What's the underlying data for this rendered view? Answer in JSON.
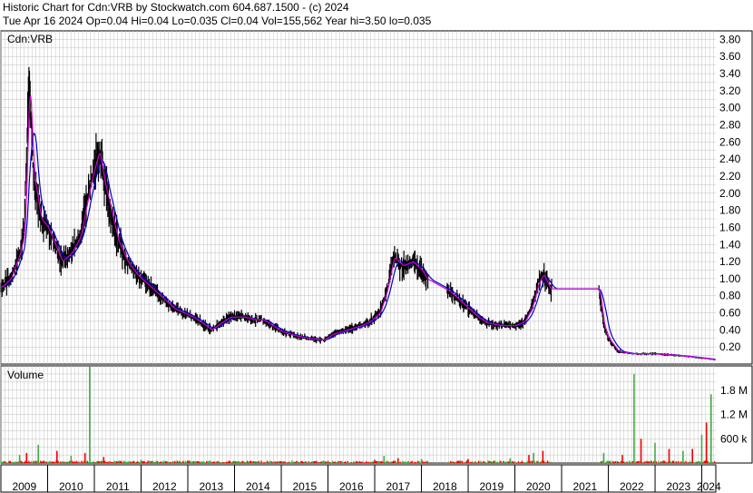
{
  "header": {
    "line1": "Historic Chart for Cdn:VRB by Stockwatch.com 604.687.1500 - (c) 2024",
    "line2": "Tue Apr 16 2024   Op=0.04   Hi=0.04   Lo=0.035   Cl=0.04   Vol=155,562   Year hi=3.50   lo=0.035"
  },
  "colors": {
    "price_bars": "#000000",
    "ma_short": "#cc00cc",
    "ma_long": "#0000cc",
    "vol_up": "#44aa44",
    "vol_down": "#ee0000",
    "grid": "#c0c0c0"
  },
  "chart_data": [
    {
      "type": "line",
      "title": "Cdn:VRB",
      "xlabel": "",
      "ylabel": "",
      "ylim": [
        0,
        3.9
      ],
      "yticks": [
        "3.80",
        "3.60",
        "3.40",
        "3.20",
        "3.00",
        "2.80",
        "2.60",
        "2.40",
        "2.20",
        "2.00",
        "1.80",
        "1.60",
        "1.40",
        "1.20",
        "1.00",
        "0.80",
        "0.60",
        "0.40",
        "0.20"
      ],
      "x_range": [
        2009.0,
        2024.3
      ],
      "x_ticks": [
        "2009",
        "2010",
        "2011",
        "2012",
        "2013",
        "2014",
        "2015",
        "2016",
        "2017",
        "2018",
        "2019",
        "2020",
        "2021",
        "2022",
        "2023",
        "2024"
      ],
      "grid": true,
      "series": [
        {
          "values": [
            [
              2009.0,
              0.9
            ],
            [
              2009.2,
              1.0
            ],
            [
              2009.4,
              1.3
            ],
            [
              2009.5,
              1.55
            ],
            [
              2009.6,
              3.35
            ],
            [
              2009.7,
              2.2
            ],
            [
              2009.85,
              1.7
            ],
            [
              2010.0,
              1.6
            ],
            [
              2010.15,
              1.4
            ],
            [
              2010.3,
              1.2
            ],
            [
              2010.5,
              1.3
            ],
            [
              2010.7,
              1.5
            ],
            [
              2010.8,
              1.8
            ],
            [
              2010.95,
              2.2
            ],
            [
              2011.1,
              2.5
            ],
            [
              2011.2,
              2.15
            ],
            [
              2011.35,
              1.8
            ],
            [
              2011.5,
              1.45
            ],
            [
              2011.7,
              1.2
            ],
            [
              2011.9,
              1.05
            ],
            [
              2012.1,
              0.95
            ],
            [
              2012.3,
              0.85
            ],
            [
              2012.5,
              0.75
            ],
            [
              2012.7,
              0.65
            ],
            [
              2012.9,
              0.6
            ],
            [
              2013.1,
              0.55
            ],
            [
              2013.3,
              0.48
            ],
            [
              2013.5,
              0.4
            ],
            [
              2013.7,
              0.48
            ],
            [
              2013.9,
              0.55
            ],
            [
              2014.2,
              0.55
            ],
            [
              2014.4,
              0.52
            ],
            [
              2014.6,
              0.52
            ],
            [
              2014.8,
              0.45
            ],
            [
              2015.0,
              0.38
            ],
            [
              2015.3,
              0.33
            ],
            [
              2015.6,
              0.3
            ],
            [
              2015.9,
              0.28
            ],
            [
              2016.1,
              0.35
            ],
            [
              2016.4,
              0.4
            ],
            [
              2016.7,
              0.45
            ],
            [
              2016.9,
              0.5
            ],
            [
              2017.1,
              0.6
            ],
            [
              2017.25,
              0.85
            ],
            [
              2017.4,
              1.25
            ],
            [
              2017.6,
              1.15
            ],
            [
              2017.8,
              1.2
            ],
            [
              2018.0,
              1.1
            ],
            [
              2018.1,
              1.0
            ],
            [
              2018.6,
              0.85
            ],
            [
              2018.8,
              0.75
            ],
            [
              2019.0,
              0.65
            ],
            [
              2019.2,
              0.55
            ],
            [
              2019.4,
              0.48
            ],
            [
              2019.7,
              0.45
            ],
            [
              2020.0,
              0.45
            ],
            [
              2020.2,
              0.5
            ],
            [
              2020.35,
              0.65
            ],
            [
              2020.5,
              0.95
            ],
            [
              2020.6,
              1.05
            ],
            [
              2020.75,
              0.88
            ],
            [
              2021.8,
              0.88
            ],
            [
              2021.9,
              0.45
            ],
            [
              2022.0,
              0.3
            ],
            [
              2022.2,
              0.15
            ],
            [
              2022.5,
              0.12
            ],
            [
              2023.0,
              0.12
            ],
            [
              2023.5,
              0.1
            ],
            [
              2024.0,
              0.07
            ],
            [
              2024.3,
              0.05
            ]
          ]
        }
      ]
    },
    {
      "type": "bar",
      "title": "Volume",
      "yticks": [
        "1.8 M",
        "1.2 M",
        "600 k"
      ],
      "ylim": [
        0,
        2.4
      ],
      "units": "millions of shares",
      "spikes": [
        [
          2009.4,
          0.2
        ],
        [
          2009.55,
          0.25
        ],
        [
          2009.8,
          0.45
        ],
        [
          2010.2,
          0.3
        ],
        [
          2010.5,
          0.18
        ],
        [
          2010.8,
          0.25
        ],
        [
          2010.9,
          2.4
        ],
        [
          2011.2,
          0.15
        ],
        [
          2012.0,
          0.08
        ],
        [
          2013.0,
          0.06
        ],
        [
          2014.0,
          0.05
        ],
        [
          2015.0,
          0.04
        ],
        [
          2016.0,
          0.04
        ],
        [
          2017.0,
          0.08
        ],
        [
          2017.2,
          0.18
        ],
        [
          2017.5,
          0.12
        ],
        [
          2018.0,
          0.1
        ],
        [
          2019.0,
          0.1
        ],
        [
          2019.9,
          0.12
        ],
        [
          2020.3,
          0.2
        ],
        [
          2020.4,
          0.25
        ],
        [
          2020.6,
          0.3
        ],
        [
          2021.9,
          0.25
        ],
        [
          2022.3,
          0.2
        ],
        [
          2022.55,
          2.2
        ],
        [
          2022.7,
          0.6
        ],
        [
          2023.0,
          0.5
        ],
        [
          2023.3,
          0.35
        ],
        [
          2023.6,
          0.3
        ],
        [
          2023.8,
          0.35
        ],
        [
          2024.0,
          0.7
        ],
        [
          2024.1,
          1.0
        ],
        [
          2024.2,
          1.7
        ]
      ]
    }
  ]
}
